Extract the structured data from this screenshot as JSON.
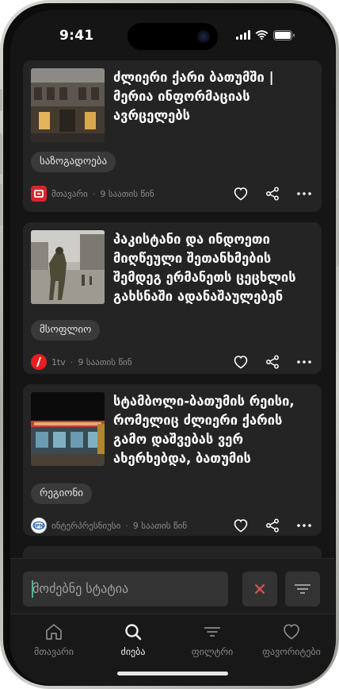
{
  "status_bar": {
    "time": "9:41"
  },
  "articles": [
    {
      "title": "ძლიერი ქარი ბათუმში | მერია ინფორმაციას ავრცელებს",
      "category": "საზოგადოება",
      "source": "მთავარი",
      "time_ago": "9 საათის წინ",
      "source_logo_color": "#d7262f"
    },
    {
      "title": "პაკისტანი და ინდოეთი მიღწეული შეთანხმების შემდეგ ერმანეთს ცეცხლის გახსნაში ადანაშაულებენ",
      "category": "მსოფლიო",
      "source": "1tv",
      "time_ago": "9 საათის წინ",
      "source_logo_color": "#e31e24"
    },
    {
      "title": "სტამბოლი-ბათუმის რეისი, რომელიც ძლიერი ქარის გამო დაშვებას ვერ ახერხებდა, ბათუმის აეროპორტში დაეშვა",
      "category": "რეგიონი",
      "source": "ინტერპრესნიუსი",
      "time_ago": "9 საათის წინ",
      "source_logo_color": "#1f5fae"
    }
  ],
  "search": {
    "placeholder": "მოძებნე სტატია"
  },
  "tabs": [
    {
      "label": "მთავარი",
      "icon": "home-icon",
      "active": false
    },
    {
      "label": "ძიება",
      "icon": "search-icon",
      "active": true
    },
    {
      "label": "ფილტრი",
      "icon": "filter-icon",
      "active": false
    },
    {
      "label": "ფავორიტები",
      "icon": "heart-icon",
      "active": false
    }
  ],
  "colors": {
    "background": "#151515",
    "card": "#242424",
    "chip": "#3a3a3a",
    "clear_button": "#e5534b",
    "caret": "#4fb38f"
  }
}
